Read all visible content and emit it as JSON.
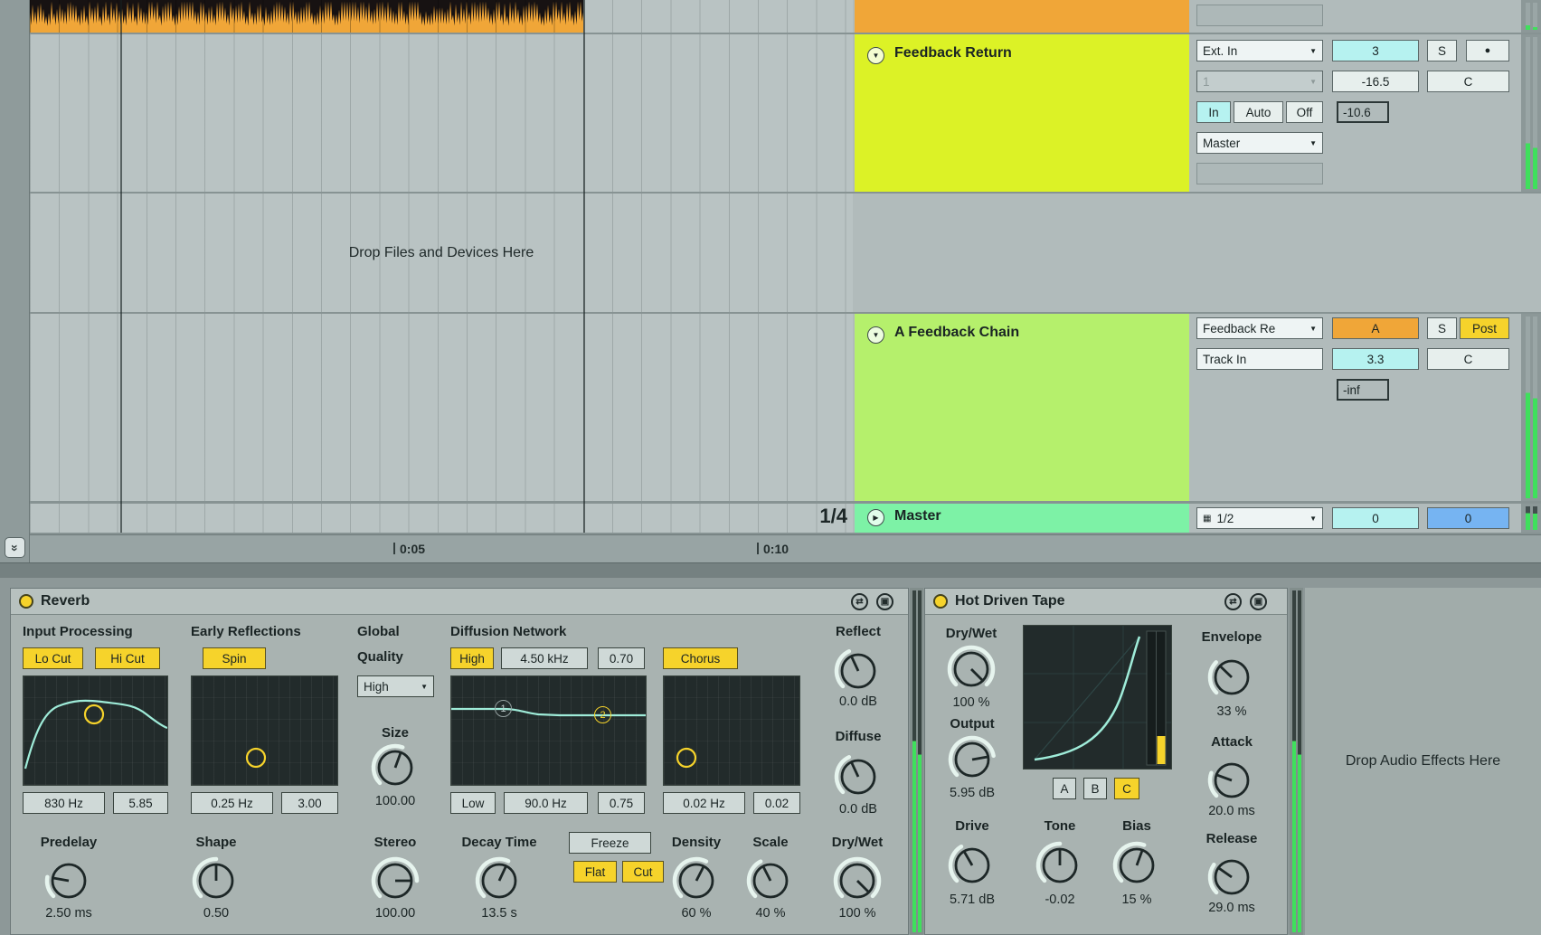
{
  "colors": {
    "track_orange": "#f0a638",
    "track_feedback_return": "#dcf226",
    "track_feedback_chain": "#b5f06c",
    "track_master": "#7df2a6",
    "button_yellow": "#f6d32b",
    "value_cyan": "#b6f2f0",
    "value_blue": "#76b4f2",
    "curve_cyan": "#9fecd9",
    "meter_green": "#3fe05c"
  },
  "icons": {
    "fold": "▼",
    "fold_master": "▶",
    "dropdown": "▼",
    "record": "●",
    "hot_swap": "⇄",
    "save": "▣",
    "channel_grid": "▦",
    "scroll": "»"
  },
  "arrangement": {
    "drop_zone": "Drop Files and Devices Here",
    "grid_quantize": "1/4",
    "ruler_ticks": [
      "0:05",
      "0:10"
    ],
    "tracks": {
      "feedback_return": {
        "name": "Feedback Return",
        "io": {
          "input": "Ext. In",
          "channel": "1",
          "monitor_in": "In",
          "monitor_auto": "Auto",
          "monitor_off": "Off",
          "output": "Master"
        },
        "mixer": {
          "send": "3",
          "solo": "S",
          "volume": "-16.5",
          "pan": "C",
          "meter": "-10.6"
        }
      },
      "feedback_chain": {
        "name": "A Feedback Chain",
        "io": {
          "input": "Feedback Re",
          "monitor": "Track In"
        },
        "mixer": {
          "crossfade": "A",
          "solo": "S",
          "pre_post": "Post",
          "send": "3.3",
          "pan": "C",
          "volume": "-inf"
        }
      },
      "master": {
        "name": "Master",
        "io": {
          "output": "1/2"
        },
        "mixer": {
          "cue": "0",
          "volume": "0"
        }
      }
    }
  },
  "device_panel": {
    "drop_zone": "Drop Audio Effects Here",
    "reverb": {
      "title": "Reverb",
      "input_processing": {
        "label": "Input Processing",
        "lo_cut": "Lo Cut",
        "hi_cut": "Hi Cut",
        "freq": "830 Hz",
        "q": "5.85"
      },
      "early_reflections": {
        "label": "Early Reflections",
        "spin": "Spin",
        "rate": "0.25 Hz",
        "amount": "3.00"
      },
      "global": {
        "label": "Global",
        "quality_label": "Quality",
        "quality": "High",
        "size_label": "Size",
        "size": "100.00"
      },
      "diffusion": {
        "label": "Diffusion Network",
        "hi_on": "High",
        "hi_freq": "4.50 kHz",
        "hi_q": "0.70",
        "lo_on": "Low",
        "lo_freq": "90.0 Hz",
        "lo_q": "0.75",
        "node1": "1",
        "node2": "2"
      },
      "chorus": {
        "label": "Chorus",
        "rate": "0.02 Hz",
        "amount": "0.02"
      },
      "reflect": {
        "label": "Reflect",
        "value": "0.0 dB"
      },
      "diffuse": {
        "label": "Diffuse",
        "value": "0.0 dB"
      },
      "predelay": {
        "label": "Predelay",
        "value": "2.50 ms"
      },
      "shape": {
        "label": "Shape",
        "value": "0.50"
      },
      "stereo": {
        "label": "Stereo",
        "value": "100.00"
      },
      "decay": {
        "label": "Decay Time",
        "value": "13.5 s"
      },
      "freeze": {
        "freeze": "Freeze",
        "flat": "Flat",
        "cut": "Cut"
      },
      "density": {
        "label": "Density",
        "value": "60 %"
      },
      "scale": {
        "label": "Scale",
        "value": "40 %"
      },
      "dry_wet": {
        "label": "Dry/Wet",
        "value": "100 %"
      }
    },
    "hot_driven_tape": {
      "title": "Hot Driven Tape",
      "dry_wet": {
        "label": "Dry/Wet",
        "value": "100 %"
      },
      "output": {
        "label": "Output",
        "value": "5.95 dB"
      },
      "curve_a": "A",
      "curve_b": "B",
      "curve_c": "C",
      "envelope": {
        "label": "Envelope",
        "value": "33 %"
      },
      "attack": {
        "label": "Attack",
        "value": "20.0 ms"
      },
      "release": {
        "label": "Release",
        "value": "29.0 ms"
      },
      "drive": {
        "label": "Drive",
        "value": "5.71 dB"
      },
      "tone": {
        "label": "Tone",
        "value": "-0.02"
      },
      "bias": {
        "label": "Bias",
        "value": "15 %"
      }
    }
  }
}
